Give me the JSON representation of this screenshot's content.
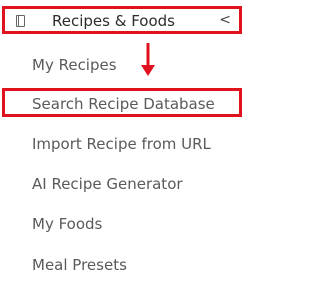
{
  "header": {
    "title": "Recipes & Foods",
    "chevron": "<",
    "icon": "book-icon"
  },
  "items": [
    {
      "label": "My Recipes"
    },
    {
      "label": "Search Recipe Database"
    },
    {
      "label": "Import Recipe from URL"
    },
    {
      "label": "AI Recipe Generator"
    },
    {
      "label": "My Foods"
    },
    {
      "label": "Meal Presets"
    }
  ],
  "colors": {
    "highlight": "#e0121d",
    "text": "#5a5a5a"
  }
}
